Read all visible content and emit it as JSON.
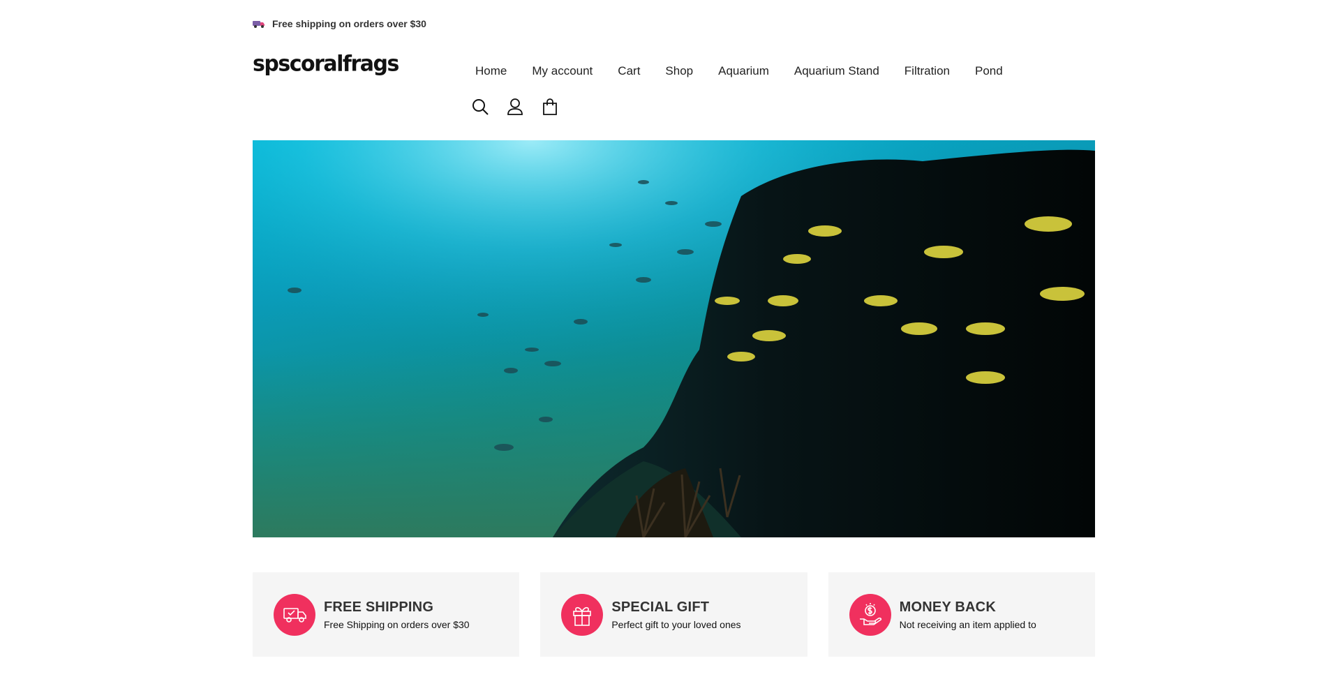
{
  "announcement": {
    "icon": "delivery-truck-icon",
    "text": "Free shipping on orders over $30"
  },
  "header": {
    "logo": "spscoralfrags",
    "nav": [
      {
        "label": "Home"
      },
      {
        "label": "My account"
      },
      {
        "label": "Cart"
      },
      {
        "label": "Shop"
      },
      {
        "label": "Aquarium"
      },
      {
        "label": "Aquarium Stand"
      },
      {
        "label": "Filtration"
      },
      {
        "label": "Pond"
      }
    ],
    "icons": [
      "search-icon",
      "account-icon",
      "shopping-bag-icon"
    ]
  },
  "hero": {
    "image": "underwater-reef-with-fish"
  },
  "features": [
    {
      "icon": "shipping-truck-icon",
      "title": "FREE SHIPPING",
      "description": "Free Shipping on orders over $30"
    },
    {
      "icon": "gift-icon",
      "title": "SPECIAL GIFT",
      "description": "Perfect gift to your loved ones"
    },
    {
      "icon": "money-back-icon",
      "title": "MONEY BACK",
      "description": "Not receiving an item applied to"
    }
  ],
  "colors": {
    "accent": "#f0305e",
    "feature_bg": "#f5f5f5",
    "text": "#222222"
  }
}
